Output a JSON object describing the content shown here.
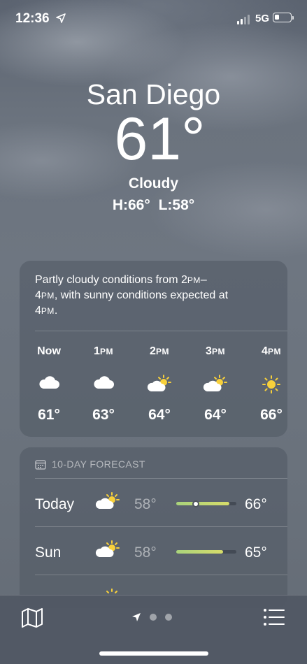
{
  "status_bar": {
    "time": "12:36",
    "network": "5G",
    "battery_level": 0.3
  },
  "current": {
    "city": "San Diego",
    "temperature": "61°",
    "condition": "Cloudy",
    "hi_lo": "H:66°  L:58°"
  },
  "hourly": {
    "summary_a": "Partly cloudy conditions from 2",
    "summary_pm1": "PM",
    "summary_b": "–",
    "summary_c": "4",
    "summary_pm2": "PM",
    "summary_d": ", with sunny conditions expected at",
    "summary_e": "4",
    "summary_pm3": "PM",
    "summary_f": ".",
    "hours": [
      {
        "label_num": "Now",
        "label_suffix": "",
        "icon": "cloud-icon",
        "temp": "61°"
      },
      {
        "label_num": "1",
        "label_suffix": "PM",
        "icon": "cloud-icon",
        "temp": "63°"
      },
      {
        "label_num": "2",
        "label_suffix": "PM",
        "icon": "partly-sunny-icon",
        "temp": "64°"
      },
      {
        "label_num": "3",
        "label_suffix": "PM",
        "icon": "partly-sunny-icon",
        "temp": "64°"
      },
      {
        "label_num": "4",
        "label_suffix": "PM",
        "icon": "sun-icon",
        "temp": "66°"
      }
    ]
  },
  "forecast": {
    "header": "10-DAY FORECAST",
    "days": [
      {
        "day": "Today",
        "icon": "partly-sunny-icon",
        "low": "58°",
        "high": "66°",
        "bar_start": 0.0,
        "bar_end": 0.88,
        "current_marker": 0.33
      },
      {
        "day": "Sun",
        "icon": "partly-sunny-icon",
        "low": "58°",
        "high": "65°",
        "bar_start": 0.0,
        "bar_end": 0.78
      }
    ]
  },
  "colors": {
    "accent_bar_start": "#a9d37c",
    "accent_bar_end": "#d7dc6a",
    "sun": "#f7d03b"
  }
}
